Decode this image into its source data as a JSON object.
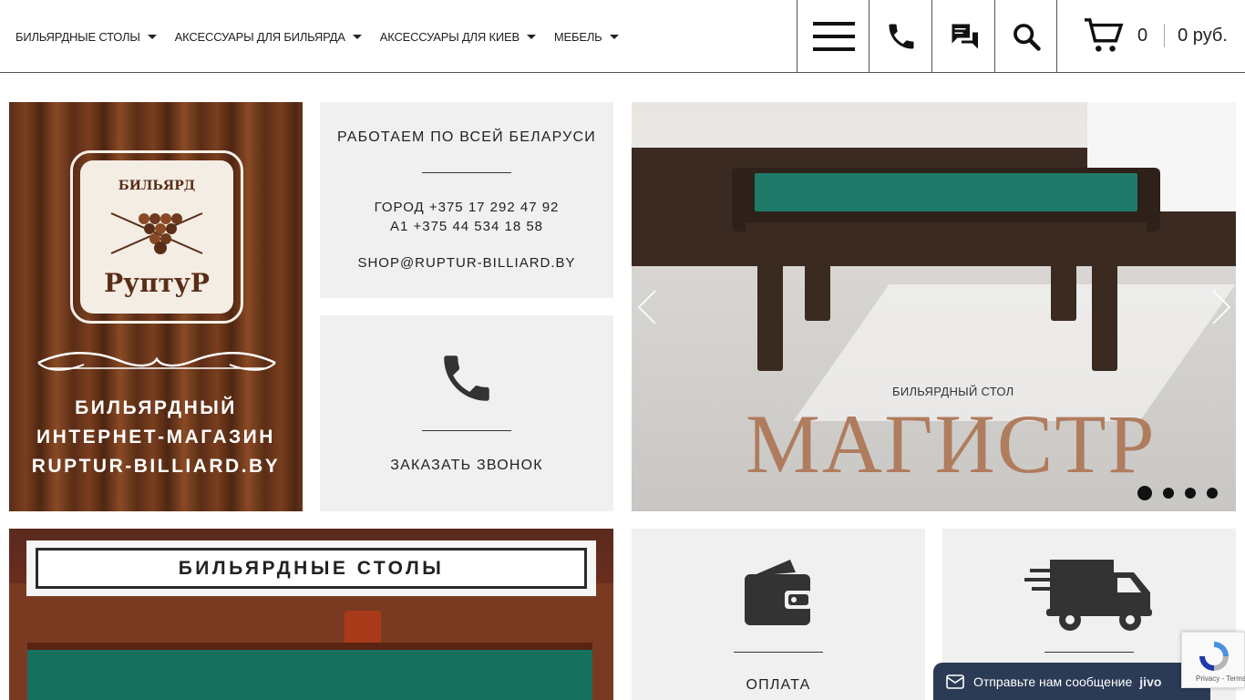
{
  "header": {
    "nav": [
      {
        "label": "БИЛЬЯРДНЫЕ СТОЛЫ"
      },
      {
        "label": "АКСЕССУАРЫ ДЛЯ БИЛЬЯРДА"
      },
      {
        "label": "АКСЕССУАРЫ ДЛЯ КИЕВ"
      },
      {
        "label": "МЕБЕЛЬ"
      }
    ],
    "cart": {
      "count": "0",
      "sum": "0 руб."
    },
    "icons": [
      "menu-icon",
      "phone-icon",
      "chat-icon",
      "search-icon",
      "cart-icon"
    ]
  },
  "logo_tile": {
    "logo_small": "БИЛЬЯРД",
    "logo_big": "РуптуР",
    "caption_lines": [
      "БИЛЬЯРДНЫЙ",
      "ИНТЕРНЕТ-МАГАЗИН",
      "RUPTUR-BILLIARD.BY"
    ]
  },
  "contacts": {
    "title": "РАБОТАЕМ ПО ВСЕЙ БЕЛАРУСИ",
    "city_phone": "ГОРОД +375 17 292 47 92",
    "a1_phone": "A1 +375 44 534 18 58",
    "email": "SHOP@RUPTUR-BILLIARD.BY"
  },
  "call": {
    "label": "ЗАКАЗАТЬ ЗВОНОК"
  },
  "slider": {
    "subtitle": "БИЛЬЯРДНЫЙ СТОЛ",
    "title": "МАГИСТР",
    "dots_count": 4,
    "active_dot": 1
  },
  "tables": {
    "label": "БИЛЬЯРДНЫЕ СТОЛЫ"
  },
  "payment": {
    "label": "ОПЛАТА"
  },
  "jivo": {
    "text": "Отправьте нам сообщение",
    "brand": "jivo"
  },
  "recaptcha": {
    "text": "Privacy - Terms"
  },
  "colors": {
    "accent_text": "#222222",
    "tile_bg": "#f0f0f0",
    "jivo_bg": "#2b3a55",
    "slider_title": "#b07c5e"
  }
}
